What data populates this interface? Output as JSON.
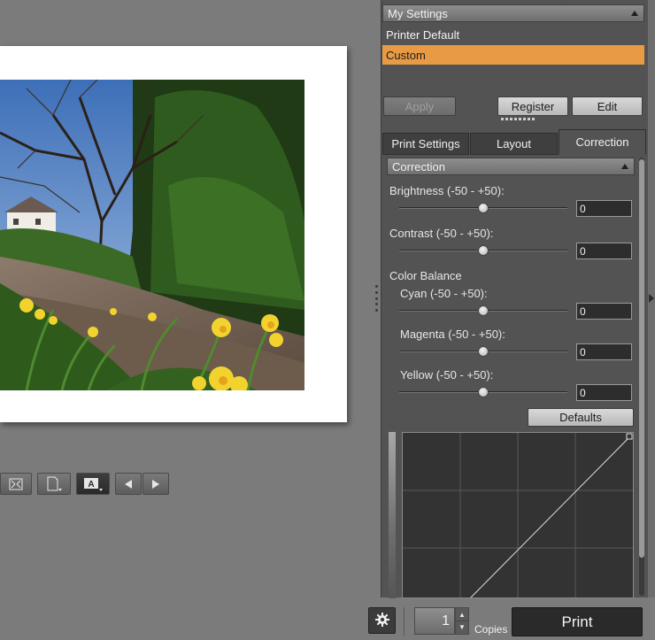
{
  "my_settings": {
    "header": "My Settings",
    "items": [
      {
        "label": "Printer Default",
        "selected": false
      },
      {
        "label": "Custom",
        "selected": true
      }
    ],
    "apply_label": "Apply",
    "register_label": "Register",
    "edit_label": "Edit"
  },
  "tabs": [
    {
      "label": "Print Settings",
      "active": false
    },
    {
      "label": "Layout",
      "active": false
    },
    {
      "label": "Correction",
      "active": true
    }
  ],
  "correction": {
    "header": "Correction",
    "brightness": {
      "label": "Brightness (-50 - +50):",
      "value": "0",
      "level": 0
    },
    "contrast": {
      "label": "Contrast (-50 - +50):",
      "value": "0",
      "level": 0
    },
    "color_balance_label": "Color Balance",
    "cyan": {
      "label": "Cyan (-50 - +50):",
      "value": "0",
      "level": 0
    },
    "magenta": {
      "label": "Magenta (-50 - +50):",
      "value": "0",
      "level": 0
    },
    "yellow": {
      "label": "Yellow (-50 - +50):",
      "value": "0",
      "level": 0
    },
    "defaults_label": "Defaults"
  },
  "bottom": {
    "copies_value": "1",
    "copies_label": "Copies",
    "print_label": "Print"
  },
  "icons": {
    "fit": "fit-to-window-icon",
    "page": "page-icon",
    "text_overlay": "text-overlay-icon",
    "prev": "previous-arrow-icon",
    "next": "next-arrow-icon",
    "gear": "gear-icon"
  },
  "colors": {
    "selection": "#e89a45",
    "panel_bg": "#535353",
    "canvas_bg": "#7b7b7b"
  }
}
